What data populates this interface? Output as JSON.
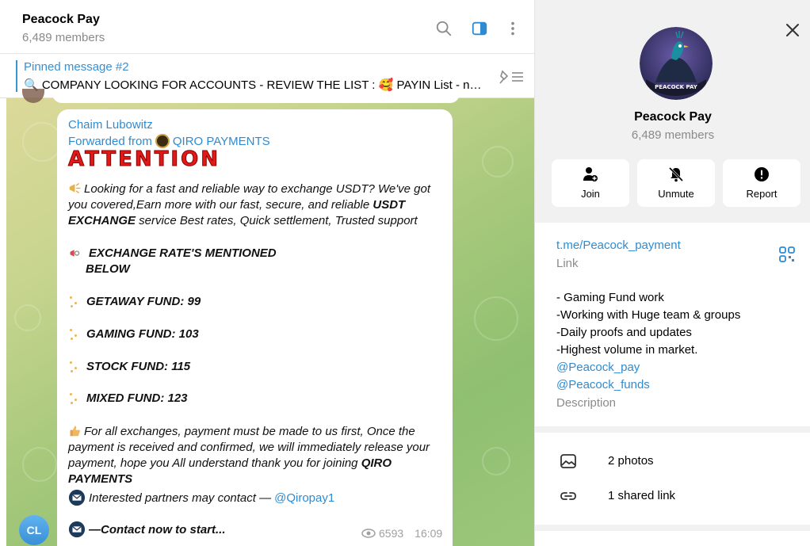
{
  "chat": {
    "title": "Peacock Pay",
    "subtitle": "6,489 members",
    "icons": [
      "search-icon",
      "sidebar-toggle-icon",
      "more-vertical-icon"
    ]
  },
  "pinned": {
    "title": "Pinned message #2",
    "text": "🔍 COMPANY LOOKING FOR ACCOUNTS - REVIEW THE LIST : 🥰 PAYIN  List - nee..."
  },
  "message": {
    "sender": "Chaim Lubowitz",
    "forwarded_prefix": "Forwarded from",
    "forwarded_from": "QIRO PAYMENTS",
    "headline": "ATTENTION",
    "intro_before_bold": "Looking for a fast and reliable way to exchange USDT? We've got you covered,Earn more with our fast, secure, and reliable ",
    "intro_bold": "USDT EXCHANGE",
    "intro_after_bold": " service Best rates, Quick settlement,  Trusted support",
    "rates_heading_line1": "EXCHANGE RATE'S MENTIONED",
    "rates_heading_line2": "BELOW",
    "funds": [
      "GETAWAY FUND: 99",
      "GAMING FUND: 103",
      "STOCK FUND: 115",
      "MIXED FUND: 123"
    ],
    "payment_text": "For all exchanges, payment must be made to us first, Once the payment is received and confirmed, we will immediately release your payment, hope you All understand thank you for joining ",
    "payment_bold": "QIRO PAYMENTS",
    "contact_text": "Interested partners may contact — ",
    "contact_handle": "@Qiropay1",
    "contact_now": "—Contact now to start...",
    "views": "6593",
    "time": "16:09",
    "avatar_initials": "CL"
  },
  "info": {
    "group_name": "Peacock Pay",
    "members": "6,489 members",
    "avatar_text": "PEACOCK PAY",
    "actions": [
      {
        "label": "Join",
        "icon": "add-user-icon"
      },
      {
        "label": "Unmute",
        "icon": "bell-off-icon"
      },
      {
        "label": "Report",
        "icon": "report-icon"
      }
    ],
    "link": "t.me/Peacock_payment",
    "link_caption": "Link",
    "description_lines": [
      "- Gaming Fund work",
      "-Working with Huge team & groups",
      "-Daily proofs and updates",
      "-Highest volume in market."
    ],
    "description_links": [
      "@Peacock_pay",
      "@Peacock_funds"
    ],
    "description_caption": "Description",
    "shared": [
      {
        "label": "2 photos",
        "icon": "photo-icon"
      },
      {
        "label": "1 shared link",
        "icon": "link-icon"
      }
    ]
  },
  "colors": {
    "accent": "#2f8bd1",
    "attention_red": "#e01919",
    "chat_bg_start": "#dcd99a",
    "chat_bg_end": "#8fbf70"
  }
}
